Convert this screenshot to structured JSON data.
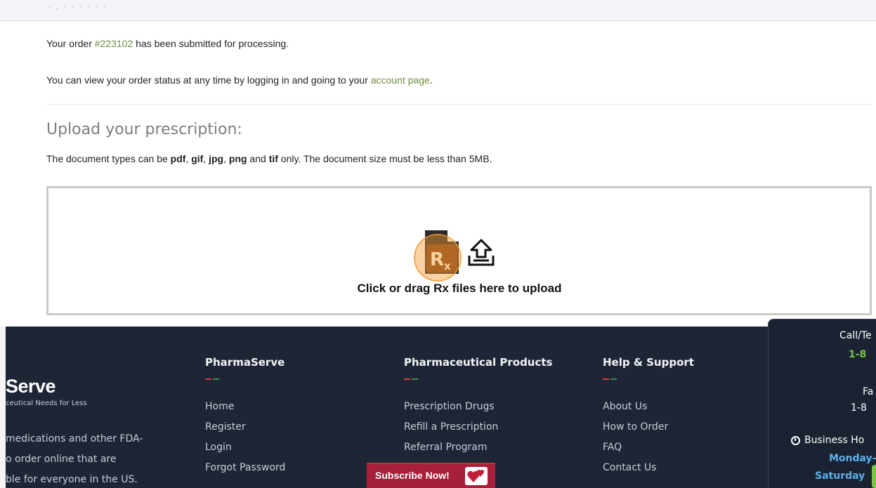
{
  "top_strip": {
    "faded_text": "·  ,  · ·   · ·   ·  ·"
  },
  "confirmation": {
    "order_prefix": "Your order ",
    "order_number": "#223102",
    "order_suffix": " has been submitted for processing.",
    "status_prefix": "You can view your order status at any time by logging in and going to your ",
    "account_link": "account page",
    "status_suffix": "."
  },
  "upload": {
    "title": "Upload your prescription:",
    "note_prefix": "The document types can be ",
    "types": [
      "pdf",
      "gif",
      "jpg",
      "png",
      "tif"
    ],
    "sep1": ", ",
    "sep2": ", ",
    "sep3": ", ",
    "and": " and ",
    "note_suffix": " only. The document size must be less than 5MB.",
    "drop_label": "Click or drag Rx files here to upload",
    "icons": [
      "rx-file-icon",
      "upload-tray-icon"
    ]
  },
  "footer": {
    "brand": "Serve",
    "tagline": "ceutical Needs for Less",
    "blurb": [
      "medications and other FDA-",
      "o order online that are",
      "ble for everyone in the US."
    ],
    "columns": [
      {
        "title": "PharmaServe",
        "links": [
          "Home",
          "Register",
          "Login",
          "Forgot Password"
        ]
      },
      {
        "title": "Pharmaceutical Products",
        "links": [
          "Prescription Drugs",
          "Refill a Prescription",
          "Referral Program"
        ]
      },
      {
        "title": "Help & Support",
        "links": [
          "About Us",
          "How to Order",
          "FAQ",
          "Contact Us"
        ]
      }
    ],
    "subscribe_label": "Subscribe Now!",
    "colors": {
      "background": "#1e2636",
      "accent_red": "#e23a3a",
      "accent_green": "#3f8d55",
      "subscribe": "#a6203a"
    }
  },
  "side_panel": {
    "call": "Call/Te",
    "phone": "1-8",
    "fax": "Fa",
    "fax_number": "1-8",
    "hours_label": "Business Ho",
    "weekday": "Monday-Fr",
    "saturday": "Saturday",
    "colors": {
      "phone": "#7dc34a",
      "hours": "#5ab0e8"
    }
  }
}
